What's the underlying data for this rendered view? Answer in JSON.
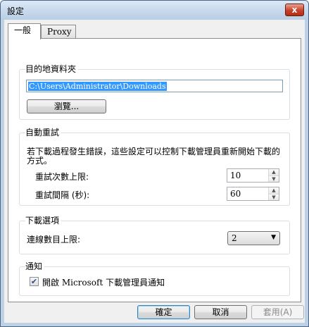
{
  "window": {
    "title": "設定",
    "close_glyph": "x",
    "close_icon": "close-icon"
  },
  "tabs": [
    {
      "label": "一般",
      "active": true
    },
    {
      "label": "Proxy",
      "active": false
    }
  ],
  "destination": {
    "label": "目的地資料夾",
    "path_value": "C:\\Users\\Administrator\\Downloads",
    "browse_label": "瀏覽..."
  },
  "auto_retry": {
    "label": "自動重試",
    "description": "若下載過程發生錯誤，這些設定可以控制下載管理員重新開始下載的方式。",
    "max_retries_label": "重試次數上限:",
    "max_retries_value": "10",
    "interval_label": "重試間隔 (秒):",
    "interval_value": "60"
  },
  "download_options": {
    "label": "下載選項",
    "max_connections_label": "連線數目上限:",
    "max_connections_value": "2"
  },
  "notification": {
    "label": "通知",
    "checkbox_checked": true,
    "checkbox_label_prefix": "開啟 ",
    "checkbox_label_product": "Microsoft",
    "checkbox_label_suffix": " 下載管理員通知"
  },
  "footer": {
    "ok_label": "確定",
    "cancel_label": "取消",
    "apply_label": "套用(A)"
  },
  "colors": {
    "selection": "#3399ff",
    "close_button": "#c8412a",
    "window_frame": "#bcd0e6"
  }
}
